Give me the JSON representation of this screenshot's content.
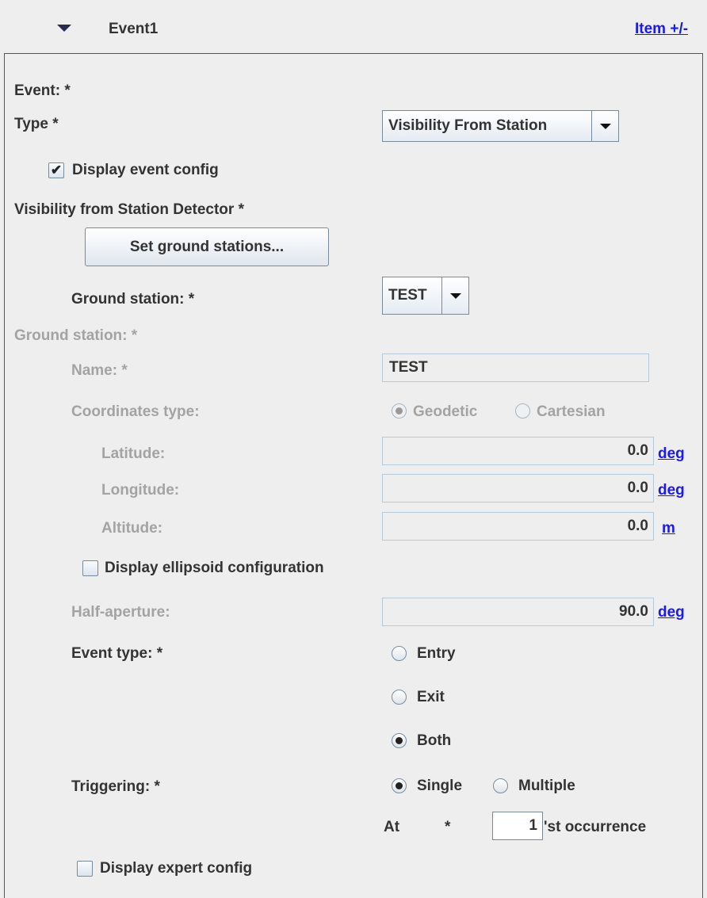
{
  "header": {
    "title": "Event1",
    "item_link": "Item +/-"
  },
  "event_label": "Event: *",
  "type": {
    "label": "Type *",
    "value": "Visibility From Station"
  },
  "display_event_config": {
    "label": "Display event config",
    "checked": true
  },
  "detector_label": "Visibility from Station Detector *",
  "set_ground_stations_button": "Set ground stations...",
  "ground_station_select": {
    "label": "Ground station: *",
    "value": "TEST"
  },
  "ground_station_section": {
    "label": "Ground station: *",
    "name": {
      "label": "Name: *",
      "value": "TEST"
    },
    "coordinates_type": {
      "label": "Coordinates type:",
      "options": [
        "Geodetic",
        "Cartesian"
      ],
      "selected": "Geodetic"
    },
    "latitude": {
      "label": "Latitude:",
      "value": "0.0",
      "unit": "deg"
    },
    "longitude": {
      "label": "Longitude:",
      "value": "0.0",
      "unit": "deg"
    },
    "altitude": {
      "label": "Altitude:",
      "value": "0.0",
      "unit": "m"
    }
  },
  "display_ellipsoid": {
    "label": "Display ellipsoid configuration",
    "checked": false
  },
  "half_aperture": {
    "label": "Half-aperture:",
    "value": "90.0",
    "unit": "deg"
  },
  "event_type": {
    "label": "Event type:  *",
    "options": [
      "Entry",
      "Exit",
      "Both"
    ],
    "selected": "Both"
  },
  "triggering": {
    "label": "Triggering: *",
    "options": [
      "Single",
      "Multiple"
    ],
    "selected": "Single"
  },
  "occurrence": {
    "at_label": "At",
    "star": "*",
    "value": "1",
    "suffix": "'st occurrence"
  },
  "display_expert": {
    "label": "Display expert config",
    "checked": false
  },
  "icons": {
    "expand": "triangle-down",
    "check": "✔"
  }
}
